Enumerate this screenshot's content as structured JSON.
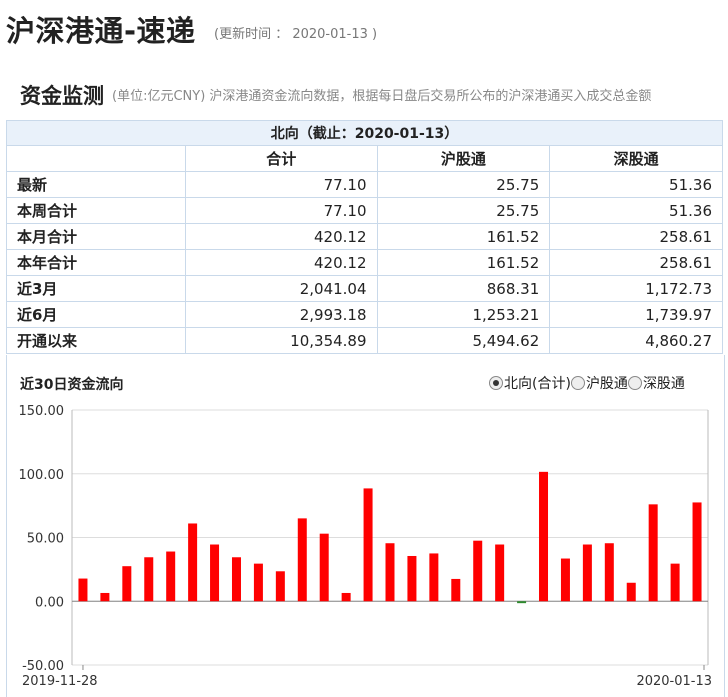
{
  "header": {
    "title": "沪深港通-速递",
    "update_text": "(更新时间 ： 2020-01-13 )"
  },
  "section": {
    "title": "资金监测",
    "description": "(单位:亿元CNY)  沪深港通资金流向数据，根据每日盘后交易所公布的沪深港通买入成交总金额"
  },
  "table": {
    "caption": "北向（截止：2020-01-13）",
    "columns": [
      "合计",
      "沪股通",
      "深股通"
    ],
    "rows": [
      {
        "label": "最新",
        "total": "77.10",
        "sh": "25.75",
        "sz": "51.36"
      },
      {
        "label": "本周合计",
        "total": "77.10",
        "sh": "25.75",
        "sz": "51.36"
      },
      {
        "label": "本月合计",
        "total": "420.12",
        "sh": "161.52",
        "sz": "258.61"
      },
      {
        "label": "本年合计",
        "total": "420.12",
        "sh": "161.52",
        "sz": "258.61"
      },
      {
        "label": "近3月",
        "total": "2,041.04",
        "sh": "868.31",
        "sz": "1,172.73"
      },
      {
        "label": "近6月",
        "total": "2,993.18",
        "sh": "1,253.21",
        "sz": "1,739.97"
      },
      {
        "label": "开通以来",
        "total": "10,354.89",
        "sh": "5,494.62",
        "sz": "4,860.27"
      }
    ]
  },
  "chart_panel": {
    "title": "近30日资金流向",
    "options": [
      {
        "label": "北向(合计)",
        "checked": true
      },
      {
        "label": "沪股通",
        "checked": false
      },
      {
        "label": "深股通",
        "checked": false
      }
    ]
  },
  "chart_data": {
    "type": "bar",
    "title": "近30日资金流向",
    "y_ticks": [
      "150.00",
      "100.00",
      "50.00",
      "0.00",
      "-50.00"
    ],
    "ylim": [
      -50,
      150
    ],
    "x_start_label": "2019-11-28",
    "x_end_label": "2020-01-13",
    "grid": true,
    "colors": {
      "positive": "#ff0000",
      "negative": "#2e8b2e",
      "grid": "#dddddd"
    },
    "series": [
      {
        "values": [
          17.8,
          6.5,
          27.5,
          34.5,
          39.0,
          61.0,
          44.5,
          34.5,
          29.5,
          23.5,
          65.0,
          53.0,
          6.5,
          88.5,
          45.5,
          35.5,
          37.5,
          17.5,
          47.5,
          44.5,
          -1.5,
          101.5,
          33.5,
          44.5,
          45.5,
          14.5,
          76.0,
          29.5,
          77.5
        ]
      }
    ]
  }
}
